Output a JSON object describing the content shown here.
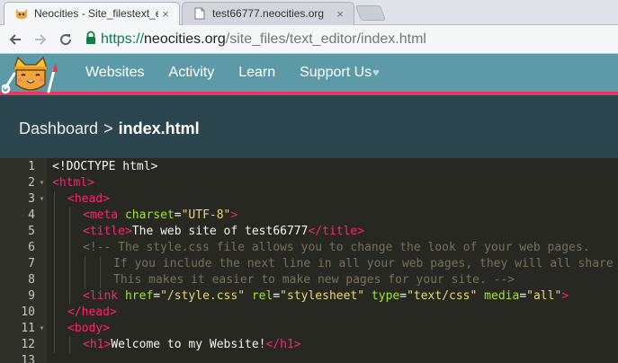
{
  "browser": {
    "tabs": [
      {
        "title": "Neocities - Site_filestext_ec",
        "active": true,
        "icon": "neocities-cat-favicon"
      },
      {
        "title": "test66777.neocities.org",
        "active": false,
        "icon": "page-icon"
      }
    ],
    "close_glyph": "×",
    "url": {
      "scheme": "https://",
      "host": "neocities.org",
      "path": "/site_files/text_editor/index.html"
    }
  },
  "site_nav": {
    "items": [
      "Websites",
      "Activity",
      "Learn",
      "Support Us"
    ],
    "heart": "♥"
  },
  "breadcrumb": {
    "root": "Dashboard",
    "separator": ">",
    "file": "index.html"
  },
  "editor": {
    "lines": [
      {
        "num": "1",
        "fold": "",
        "indent": 0,
        "tokens": [
          [
            "txt",
            "<!DOCTYPE html>"
          ]
        ]
      },
      {
        "num": "2",
        "fold": "▾",
        "indent": 0,
        "tokens": [
          [
            "tag",
            "<html>"
          ]
        ]
      },
      {
        "num": "3",
        "fold": "▾",
        "indent": 1,
        "tokens": [
          [
            "tag",
            "<head>"
          ]
        ]
      },
      {
        "num": "4",
        "fold": "",
        "indent": 2,
        "tokens": [
          [
            "tag",
            "<meta "
          ],
          [
            "attr",
            "charset"
          ],
          [
            "txt",
            "="
          ],
          [
            "str",
            "\"UTF-8\""
          ],
          [
            "tag",
            ">"
          ]
        ]
      },
      {
        "num": "5",
        "fold": "",
        "indent": 2,
        "tokens": [
          [
            "tag",
            "<title>"
          ],
          [
            "txt",
            "The web site of test66777"
          ],
          [
            "tag",
            "</title>"
          ]
        ]
      },
      {
        "num": "6",
        "fold": "",
        "indent": 2,
        "tokens": [
          [
            "com",
            "<!-- The style.css file allows you to change the look of your web pages."
          ]
        ]
      },
      {
        "num": "7",
        "fold": "",
        "indent": 4,
        "tokens": [
          [
            "com",
            "If you include the next line in all your web pages, they will all share the same look."
          ]
        ]
      },
      {
        "num": "8",
        "fold": "",
        "indent": 4,
        "tokens": [
          [
            "com",
            "This makes it easier to make new pages for your site. -->"
          ]
        ]
      },
      {
        "num": "9",
        "fold": "",
        "indent": 2,
        "tokens": [
          [
            "tag",
            "<link "
          ],
          [
            "attr",
            "href"
          ],
          [
            "txt",
            "="
          ],
          [
            "str",
            "\"/style.css\""
          ],
          [
            "txt",
            " "
          ],
          [
            "attr",
            "rel"
          ],
          [
            "txt",
            "="
          ],
          [
            "str",
            "\"stylesheet\""
          ],
          [
            "txt",
            " "
          ],
          [
            "attr",
            "type"
          ],
          [
            "txt",
            "="
          ],
          [
            "str",
            "\"text/css\""
          ],
          [
            "txt",
            " "
          ],
          [
            "attr",
            "media"
          ],
          [
            "txt",
            "="
          ],
          [
            "str",
            "\"all\""
          ],
          [
            "tag",
            ">"
          ]
        ]
      },
      {
        "num": "10",
        "fold": "",
        "indent": 1,
        "tokens": [
          [
            "tag",
            "</head>"
          ]
        ]
      },
      {
        "num": "11",
        "fold": "▾",
        "indent": 1,
        "tokens": [
          [
            "tag",
            "<body>"
          ]
        ]
      },
      {
        "num": "12",
        "fold": "",
        "indent": 2,
        "tokens": [
          [
            "tag",
            "<h1>"
          ],
          [
            "txt",
            "Welcome to my Website!"
          ],
          [
            "tag",
            "</h1>"
          ]
        ]
      },
      {
        "num": "13",
        "fold": "",
        "indent": 0,
        "tokens": []
      }
    ]
  },
  "colors": {
    "header_bg": "#5c9aa8",
    "header_accent": "#e4395b",
    "dashbar_bg": "#2c4650",
    "editor_bg": "#272822",
    "tag": "#f92672",
    "attr": "#a6e22e",
    "string": "#e6db74",
    "comment": "#75715e"
  }
}
